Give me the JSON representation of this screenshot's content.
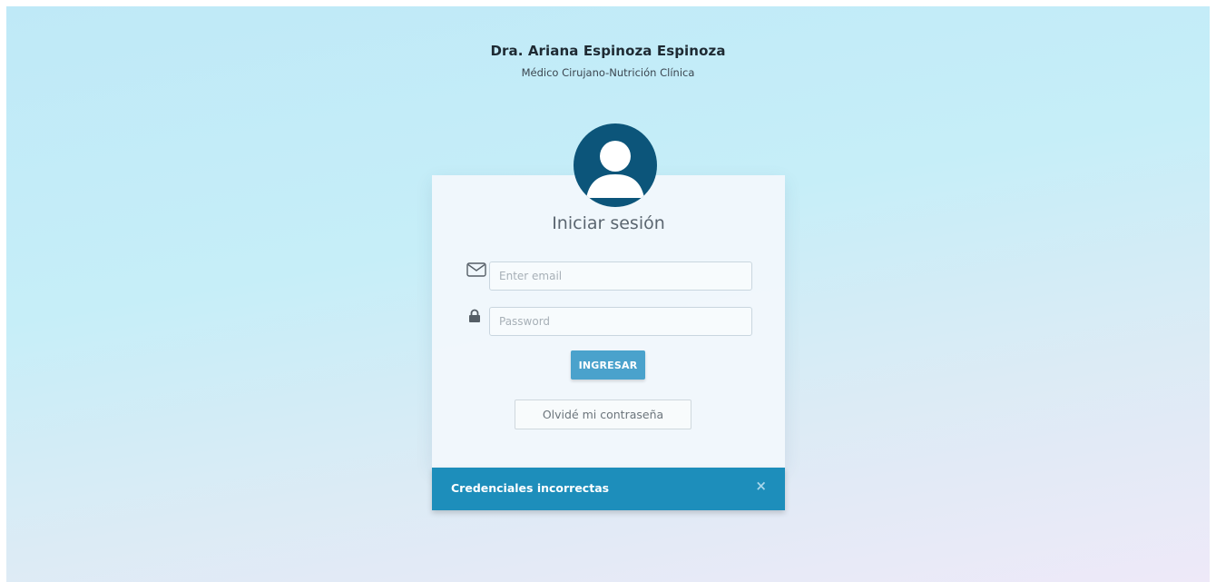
{
  "header": {
    "doctor_name": "Dra. Ariana Espinoza Espinoza",
    "doctor_title": "Médico Cirujano-Nutrición Clínica"
  },
  "login": {
    "title": "Iniciar sesión",
    "email_placeholder": "Enter email",
    "email_value": "",
    "password_placeholder": "Password",
    "password_value": "",
    "submit_label": "INGRESAR",
    "forgot_label": "Olvidé mi contraseña"
  },
  "alert": {
    "message": "Credenciales incorrectas",
    "close_symbol": "×"
  },
  "icons": {
    "avatar": "user-avatar-icon",
    "email": "envelope-icon",
    "password": "lock-icon",
    "close": "close-icon"
  },
  "colors": {
    "avatar": "#0c557a",
    "primary_button": "#4aa2cc",
    "alert_background": "#1d8ebb"
  }
}
